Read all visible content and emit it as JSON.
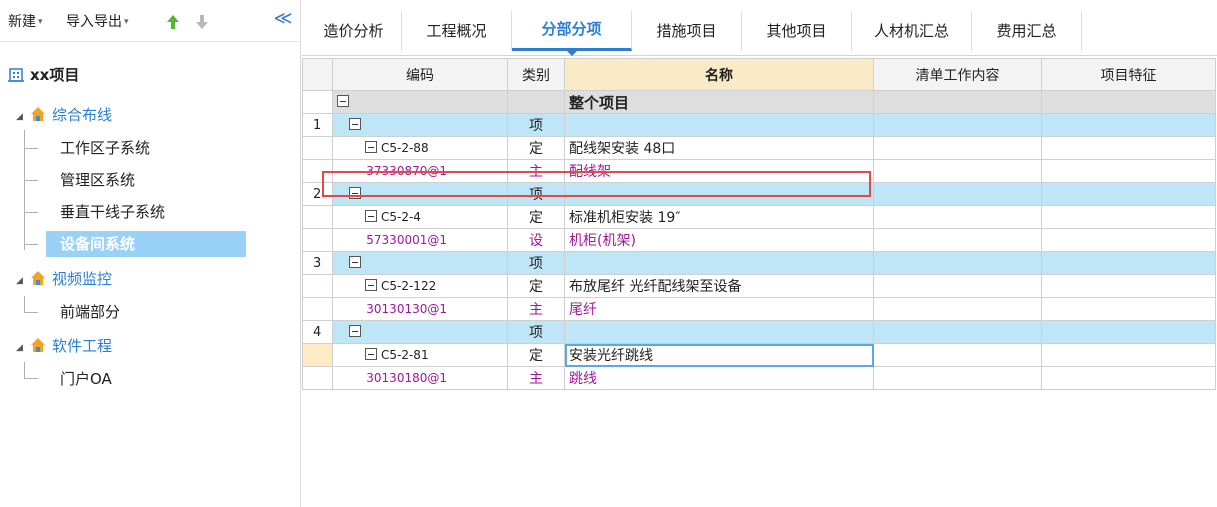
{
  "toolbar": {
    "new_label": "新建",
    "import_export_label": "导入导出",
    "caret": "▾",
    "collapse_glyph": "≪"
  },
  "tree": {
    "root": "xx项目",
    "groups": [
      {
        "label": "综合布线",
        "items": [
          "工作区子系统",
          "管理区系统",
          "垂直干线子系统",
          "设备间系统"
        ]
      },
      {
        "label": "视频监控",
        "items": [
          "前端部分"
        ]
      },
      {
        "label": "软件工程",
        "items": [
          "门户OA"
        ]
      }
    ],
    "selected": "设备间系统",
    "expand_glyph": "◢"
  },
  "tabs": [
    "造价分析",
    "工程概况",
    "分部分项",
    "措施项目",
    "其他项目",
    "人材机汇总",
    "费用汇总"
  ],
  "active_tab": "分部分项",
  "grid": {
    "columns": {
      "code": "编码",
      "type": "类别",
      "name": "名称",
      "desc": "清单工作内容",
      "feature": "项目特征"
    },
    "rows": [
      {
        "kind": "top",
        "idx": "",
        "code": "",
        "type": "",
        "name": "整个项目"
      },
      {
        "kind": "sec",
        "idx": "1",
        "code": "",
        "type": "项",
        "name": ""
      },
      {
        "kind": "quota",
        "idx": "",
        "code": "C5-2-88",
        "type": "定",
        "name": "配线架安装 48口"
      },
      {
        "kind": "res",
        "idx": "",
        "code": "37330870@1",
        "type": "主",
        "name": "配线架"
      },
      {
        "kind": "sec",
        "idx": "2",
        "code": "",
        "type": "项",
        "name": ""
      },
      {
        "kind": "quota",
        "idx": "",
        "code": "C5-2-4",
        "type": "定",
        "name": "标准机柜安装 19″"
      },
      {
        "kind": "res",
        "idx": "",
        "code": "57330001@1",
        "type": "设",
        "name": "机柜(机架)"
      },
      {
        "kind": "sec",
        "idx": "3",
        "code": "",
        "type": "项",
        "name": ""
      },
      {
        "kind": "quota",
        "idx": "",
        "code": "C5-2-122",
        "type": "定",
        "name": "布放尾纤 光纤配线架至设备"
      },
      {
        "kind": "res",
        "idx": "",
        "code": "30130130@1",
        "type": "主",
        "name": "尾纤"
      },
      {
        "kind": "sec",
        "idx": "4",
        "code": "",
        "type": "项",
        "name": ""
      },
      {
        "kind": "quota",
        "idx": "",
        "code": "C5-2-81",
        "type": "定",
        "name": "安装光纤跳线"
      },
      {
        "kind": "res",
        "idx": "",
        "code": "30130180@1",
        "type": "主",
        "name": "跳线"
      }
    ]
  },
  "colors": {
    "accent": "#2a7fd4",
    "section_row": "#bfe6f6",
    "resource_text": "#a0189a",
    "highlight_box": "#e14a4a",
    "name_header": "#fbeac7",
    "selected_tree": "#99d1f7"
  }
}
